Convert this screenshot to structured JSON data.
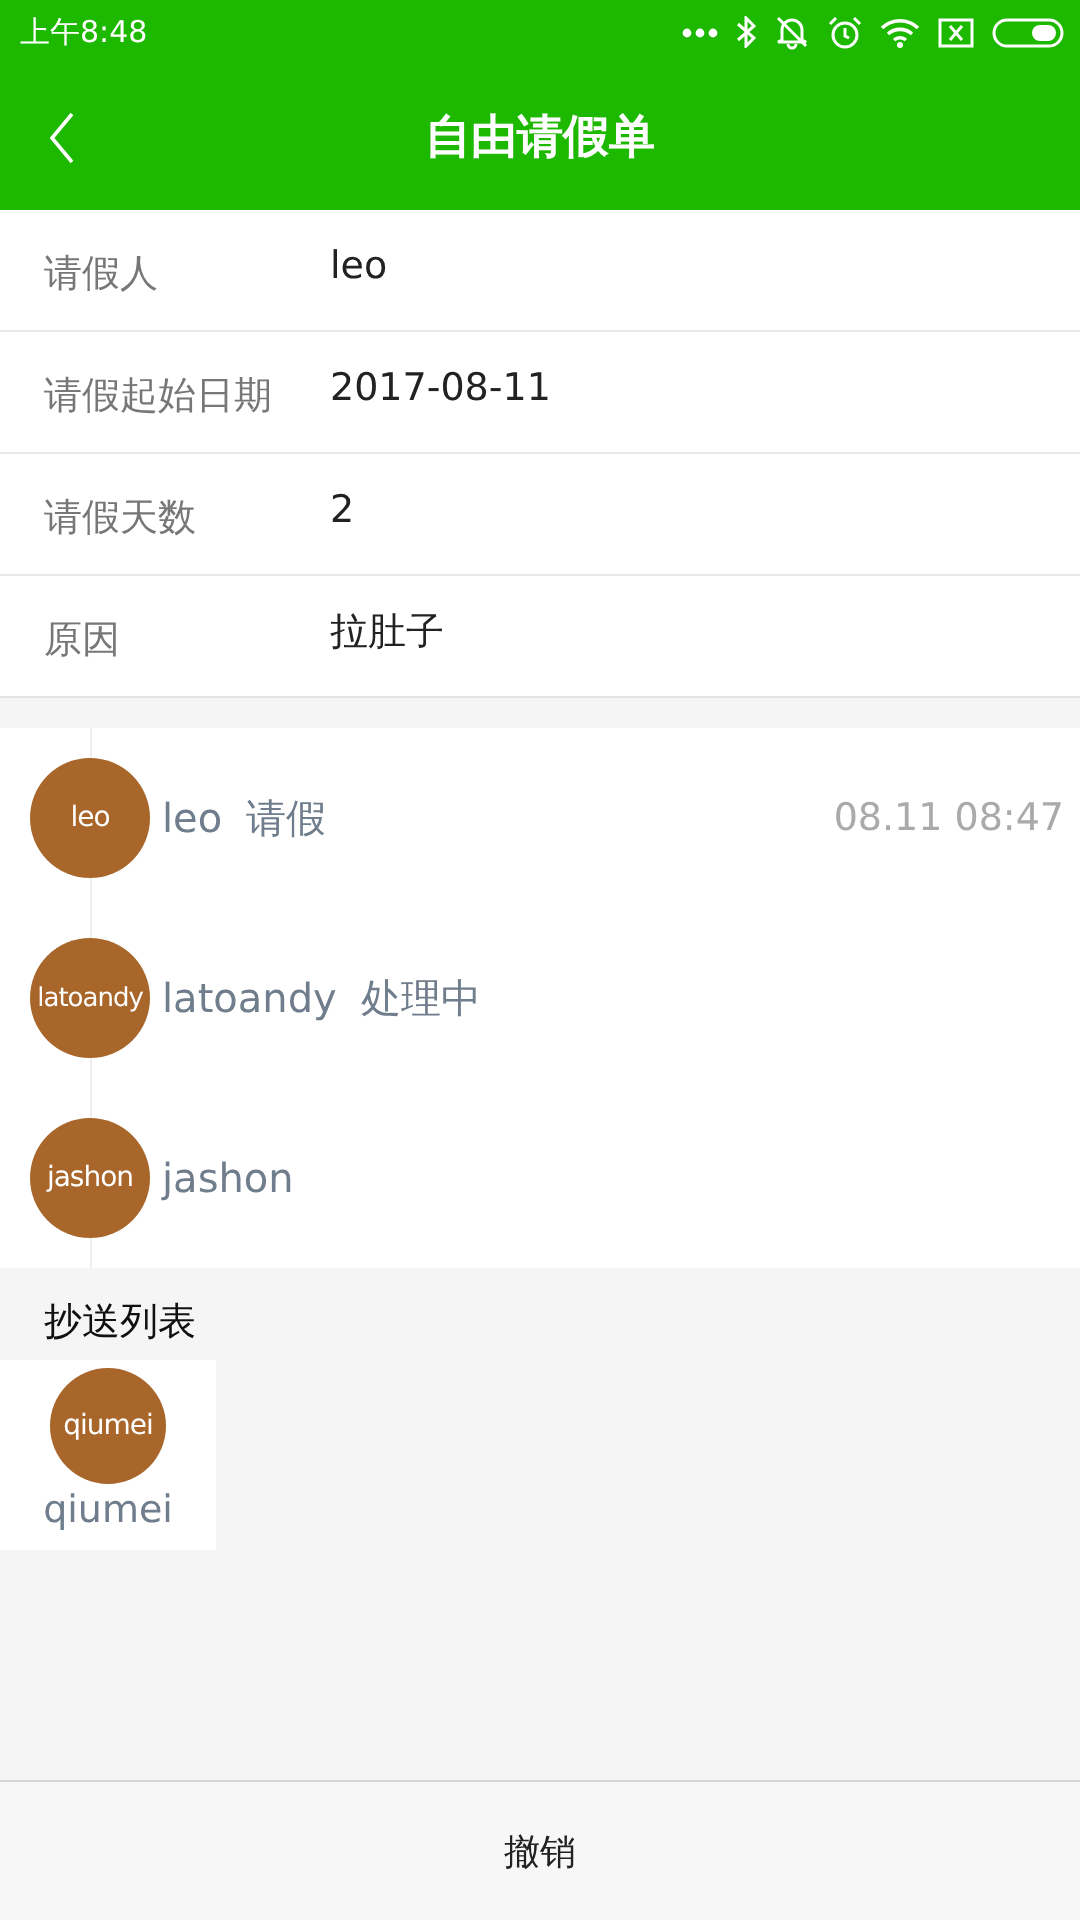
{
  "status_bar": {
    "time": "上午8:48"
  },
  "header": {
    "title": "自由请假单"
  },
  "form": [
    {
      "label": "请假人",
      "value": "leo"
    },
    {
      "label": "请假起始日期",
      "value": "2017-08-11"
    },
    {
      "label": "请假天数",
      "value": "2"
    },
    {
      "label": "原因",
      "value": "拉肚子"
    }
  ],
  "timeline": [
    {
      "avatar": "leo",
      "name": "leo",
      "action": "请假",
      "time": "08.11 08:47"
    },
    {
      "avatar": "latoandy",
      "name": "latoandy",
      "action": "处理中"
    },
    {
      "avatar": "jashon",
      "name": "jashon"
    }
  ],
  "cc": {
    "title": "抄送列表",
    "people": [
      {
        "avatar": "qiumei",
        "name": "qiumei"
      }
    ]
  },
  "footer": {
    "button": "撤销"
  }
}
